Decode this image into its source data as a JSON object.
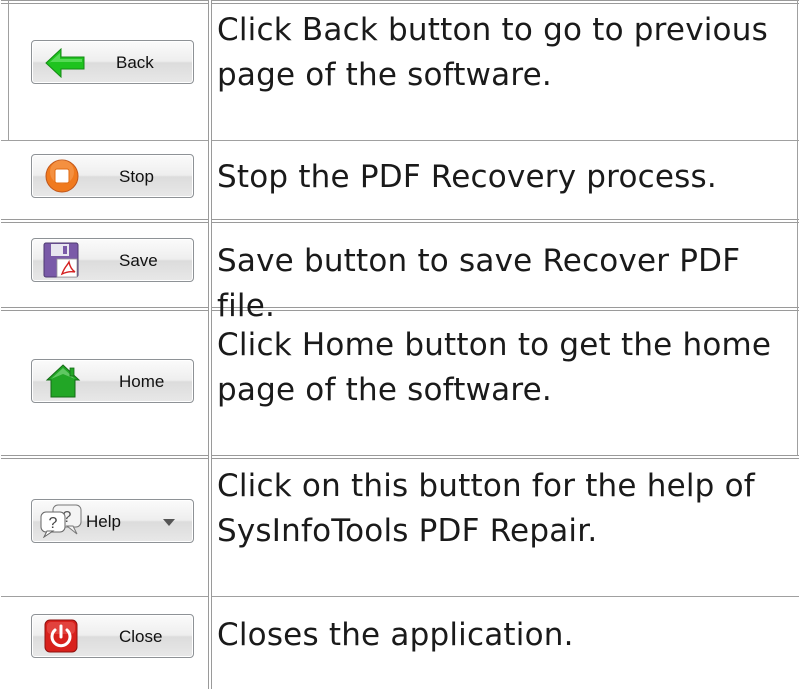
{
  "rows": [
    {
      "button": {
        "label": "Back",
        "icon": "green-left-arrow-icon"
      },
      "description": "Click Back button to go to previous page of the software."
    },
    {
      "button": {
        "label": "Stop",
        "icon": "orange-stop-icon"
      },
      "description": "Stop the PDF Recovery process."
    },
    {
      "button": {
        "label": "Save",
        "icon": "floppy-disk-pdf-icon"
      },
      "description": "Save button to save Recover PDF file."
    },
    {
      "button": {
        "label": "Home",
        "icon": "green-house-icon"
      },
      "description": "Click Home button to get the home page of the software."
    },
    {
      "button": {
        "label": "Help",
        "icon": "help-speech-bubbles-icon",
        "dropdown_icon": "chevron-down-icon"
      },
      "description": "Click on this button for the help of SysInfoTools PDF Repair."
    },
    {
      "button": {
        "label": "Close",
        "icon": "red-power-icon"
      },
      "description": "Closes the application."
    }
  ],
  "colors": {
    "arrow_green": "#1fc31f",
    "stop_orange": "#f07a1e",
    "home_green": "#22a626",
    "close_red": "#d8211c",
    "grid_line": "#a0a0a0",
    "text": "#1a1a1a"
  }
}
